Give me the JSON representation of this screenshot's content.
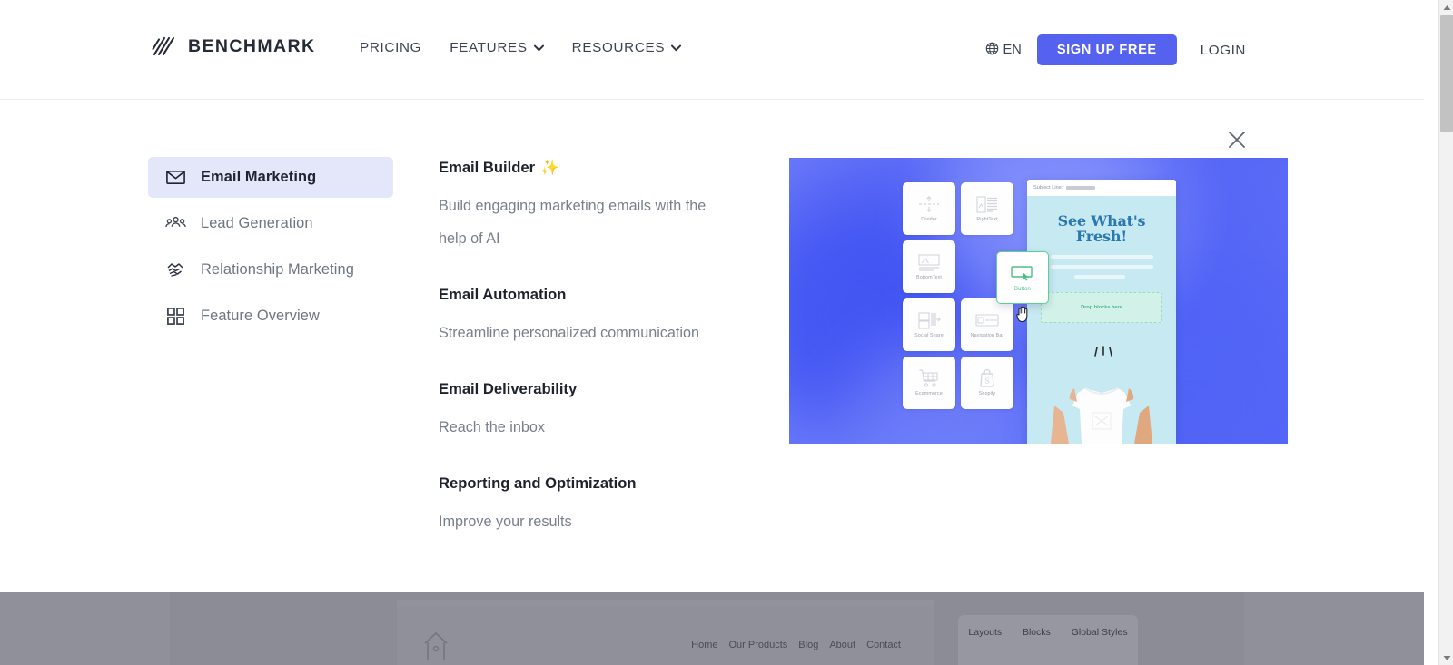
{
  "header": {
    "logo_text": "BENCHMARK",
    "logo_icon": "benchmark-slashes-logo",
    "nav": [
      {
        "label": "PRICING",
        "has_caret": false
      },
      {
        "label": "FEATURES",
        "has_caret": true
      },
      {
        "label": "RESOURCES",
        "has_caret": true
      }
    ],
    "language": {
      "icon": "globe-icon",
      "label": "EN"
    },
    "signup_label": "SIGN UP FREE",
    "login_label": "LOGIN",
    "accent_color": "#5562f0"
  },
  "mega_menu": {
    "close_icon": "close-icon",
    "sidebar": [
      {
        "label": "Email Marketing",
        "icon": "envelope-icon",
        "active": true
      },
      {
        "label": "Lead Generation",
        "icon": "people-group-icon",
        "active": false
      },
      {
        "label": "Relationship Marketing",
        "icon": "handshake-icon",
        "active": false
      },
      {
        "label": "Feature Overview",
        "icon": "grid-squares-icon",
        "active": false
      }
    ],
    "active_bg": "#e4e7f9",
    "links": [
      {
        "title": "Email Builder",
        "emoji": "✨",
        "desc": "Build engaging marketing emails with the help of AI"
      },
      {
        "title": "Email Automation",
        "emoji": "",
        "desc": "Streamline personalized communication"
      },
      {
        "title": "Email Deliverability",
        "emoji": "",
        "desc": "Reach the inbox"
      },
      {
        "title": "Reporting and Optimization",
        "emoji": "",
        "desc": "Improve your results"
      }
    ],
    "preview": {
      "tiles": [
        {
          "label": "Divider",
          "icon": "divider-icon"
        },
        {
          "label": "RightText",
          "icon": "right-text-icon"
        },
        {
          "label": "BottomText",
          "icon": "bottom-text-icon"
        },
        {
          "label": "",
          "icon": ""
        },
        {
          "label": "Social Share",
          "icon": "social-share-icon"
        },
        {
          "label": "Navigation Bar",
          "icon": "navigation-bar-icon"
        },
        {
          "label": "Ecommerce",
          "icon": "shopping-cart-icon"
        },
        {
          "label": "Shopify",
          "icon": "shopify-bag-icon"
        }
      ],
      "drag_tile": {
        "label": "Button",
        "icon": "button-block-icon",
        "cursor": "grab-hand-cursor",
        "color": "#4bbf86"
      },
      "email": {
        "subject_label": "Subject Line:",
        "headline_line1": "See What's",
        "headline_line2": "Fresh!",
        "dropzone_label": "Drop blocks here",
        "image_alt": "hands-holding-white-tshirt"
      },
      "gradient_from": "#6776f8",
      "gradient_to": "#5566f6"
    }
  },
  "background_page": {
    "nav": [
      "Home",
      "Our Products",
      "Blog",
      "About",
      "Contact"
    ],
    "panel_tabs": [
      "Layouts",
      "Blocks",
      "Global Styles"
    ],
    "home_icon": "house-icon",
    "overlay_color": "#8b8c96"
  },
  "scrollbar": {
    "up_icon": "scroll-up-arrow",
    "down_icon": "scroll-down-arrow"
  }
}
